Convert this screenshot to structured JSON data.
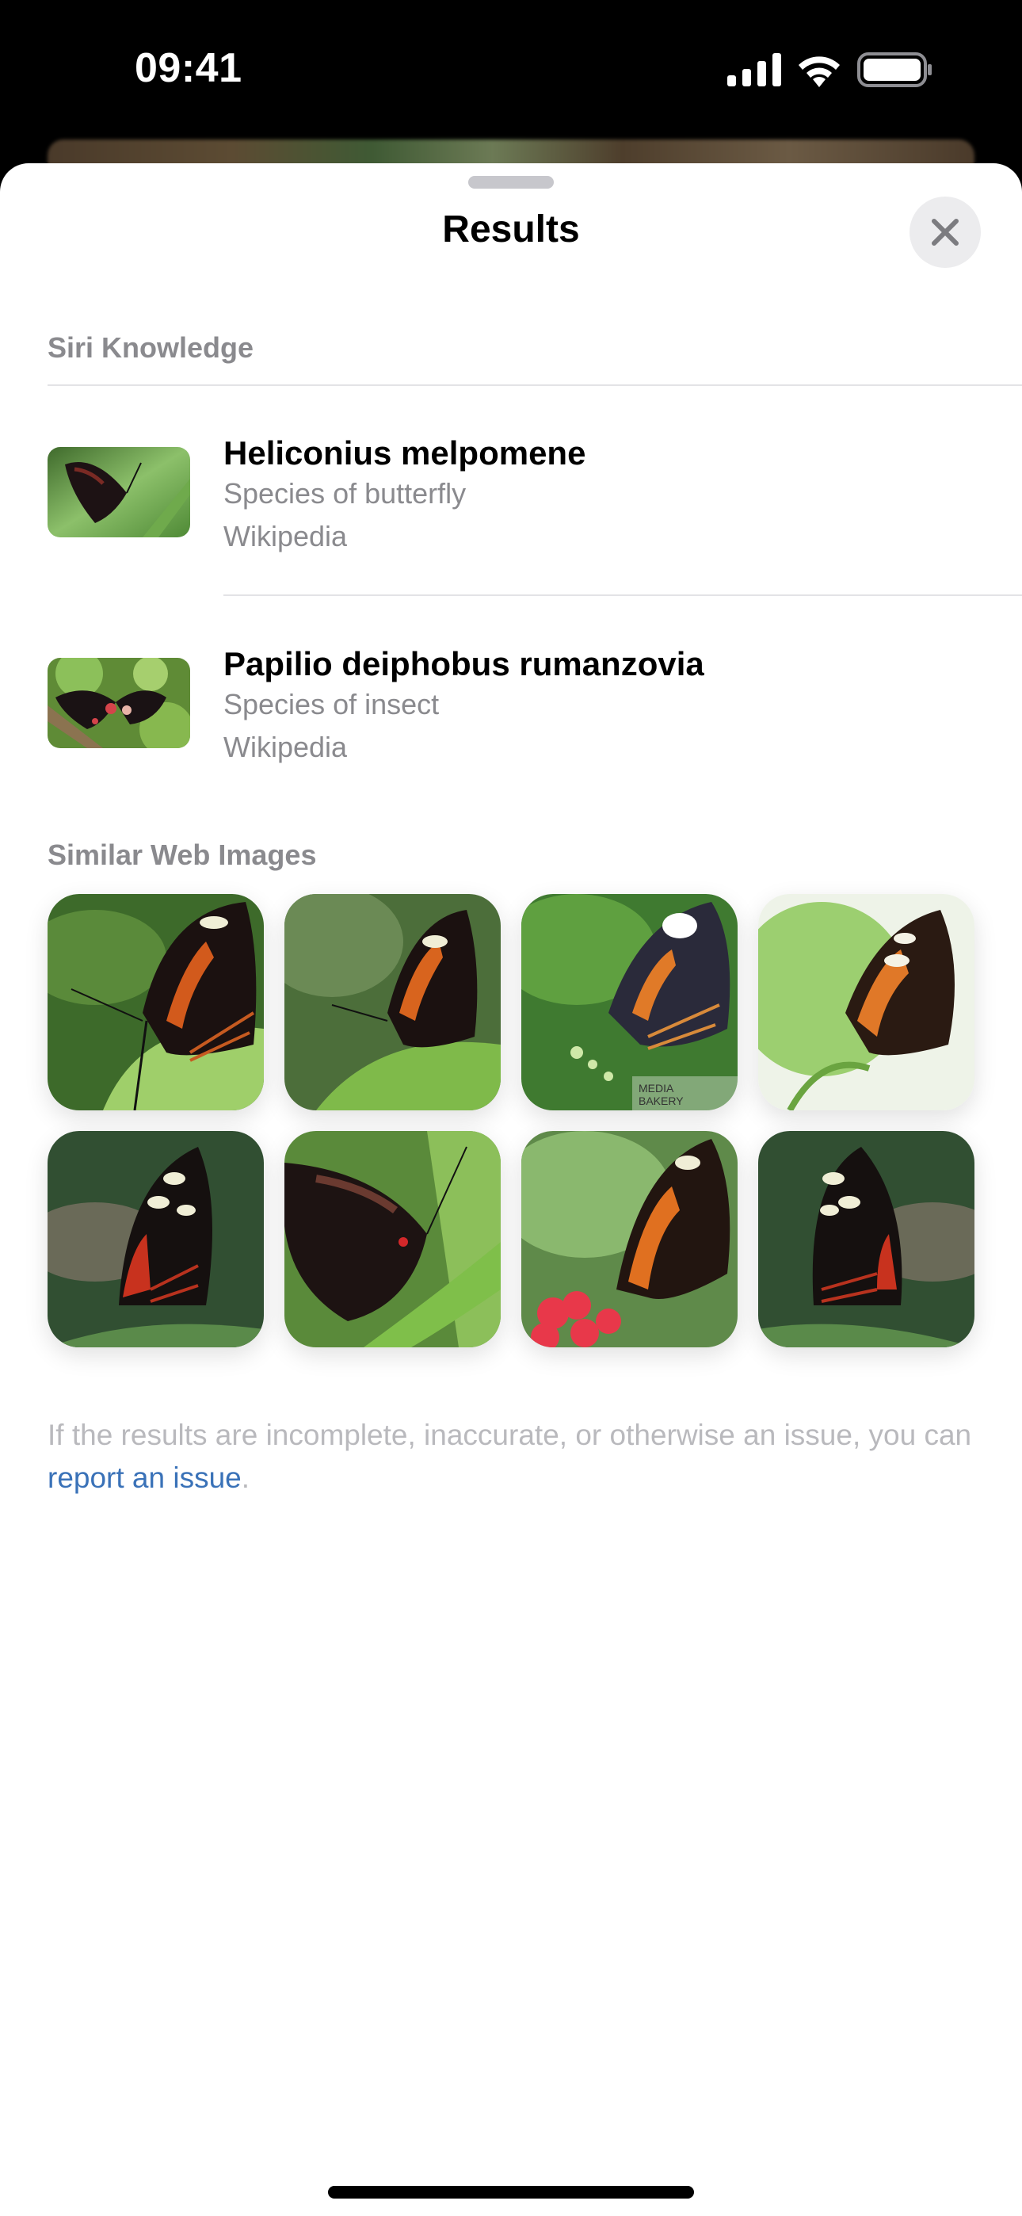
{
  "status_bar": {
    "time": "09:41",
    "icons": [
      "cellular-signal-icon",
      "wifi-icon",
      "battery-icon"
    ]
  },
  "sheet": {
    "title": "Results",
    "close_icon": "close-icon"
  },
  "siri_knowledge": {
    "header": "Siri Knowledge",
    "items": [
      {
        "title": "Heliconius melpomene",
        "subtitle": "Species of butterfly",
        "source": "Wikipedia",
        "thumbnail": "butterfly-thumbnail"
      },
      {
        "title": "Papilio deiphobus rumanzovia",
        "subtitle": "Species of insect",
        "source": "Wikipedia",
        "thumbnail": "butterfly-thumbnail"
      }
    ]
  },
  "similar_web_images": {
    "header": "Similar Web Images",
    "images": [
      {
        "description": "Butterfly with orange and black wings on leaf"
      },
      {
        "description": "Butterfly with orange stripes on green leaf"
      },
      {
        "description": "Black butterfly with white spot on flowers",
        "watermark": "MEDIA BAKERY"
      },
      {
        "description": "Butterfly with orange wings on white background"
      },
      {
        "description": "Black butterfly with red and white markings"
      },
      {
        "description": "Dark butterfly on green leaf"
      },
      {
        "description": "Butterfly on red flowers"
      },
      {
        "description": "Black butterfly with red stripes and white spots"
      }
    ]
  },
  "footer": {
    "text_before": "If the results are incomplete, inaccurate, or otherwise an issue, you can ",
    "link": "report an issue",
    "text_after": "."
  },
  "colors": {
    "link": "#3a72b8",
    "secondary_text": "#8a8a8e",
    "footer_text": "#b9b9bd"
  }
}
